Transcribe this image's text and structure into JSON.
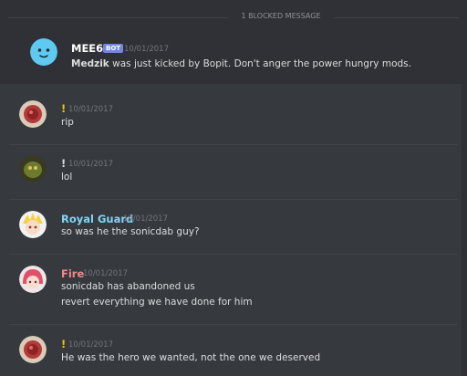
{
  "blocked_banner": {
    "label": "1 BLOCKED MESSAGE"
  },
  "messages": [
    {
      "author": "MEE6",
      "badge": "BOT",
      "timestamp": "10/01/2017",
      "name_color": "#ffffff",
      "text_bold": "Medzik",
      "text": " was just kicked by Bopit. Don't anger the power hungry mods."
    },
    {
      "author": "!",
      "timestamp": "10/01/2017",
      "name_color": "#f1c40f",
      "lines": [
        "rip"
      ]
    },
    {
      "author": "!",
      "timestamp": "10/01/2017",
      "name_color": "#dcddde",
      "lines": [
        "lol"
      ]
    },
    {
      "author": "Royal Guard",
      "timestamp": "10/01/2017",
      "name_color": "#7fd6f4",
      "lines": [
        "so was he the sonicdab guy?"
      ]
    },
    {
      "author": "Fire",
      "timestamp": "10/01/2017",
      "name_color": "#f28a8a",
      "lines": [
        "sonicdab has abandoned us",
        "revert everything we have done for him"
      ]
    },
    {
      "author": "!",
      "timestamp": "10/01/2017",
      "name_color": "#f1c40f",
      "lines": [
        "He was the hero we wanted, not the one we deserved"
      ]
    }
  ]
}
